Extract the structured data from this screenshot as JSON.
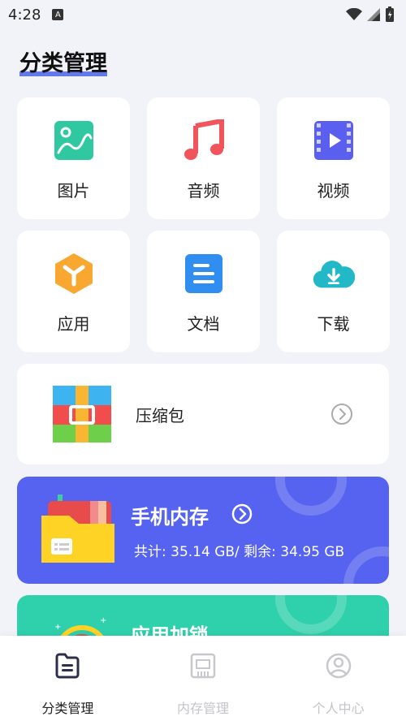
{
  "status_bar": {
    "time": "4:28",
    "notif_letter": "A"
  },
  "page": {
    "title": "分类管理"
  },
  "categories": [
    {
      "label": "图片",
      "icon": "image-icon"
    },
    {
      "label": "音频",
      "icon": "music-note-icon"
    },
    {
      "label": "视频",
      "icon": "video-icon"
    },
    {
      "label": "应用",
      "icon": "app-cube-icon"
    },
    {
      "label": "文档",
      "icon": "document-icon"
    },
    {
      "label": "下载",
      "icon": "cloud-download-icon"
    }
  ],
  "archive": {
    "label": "压缩包",
    "icon": "zip-archive-icon"
  },
  "storage": {
    "title": "手机内存",
    "info": "共计: 35.14 GB/ 剩余: 34.95 GB",
    "color": "#5663f0"
  },
  "speedup": {
    "title": "应用加锁",
    "color": "#2fd0ac"
  },
  "bottom_nav": [
    {
      "label": "分类管理",
      "active": true
    },
    {
      "label": "内存管理",
      "active": false
    },
    {
      "label": "个人中心",
      "active": false
    }
  ],
  "colors": {
    "accent": "#4a62e6",
    "background": "#f2f3f8"
  }
}
